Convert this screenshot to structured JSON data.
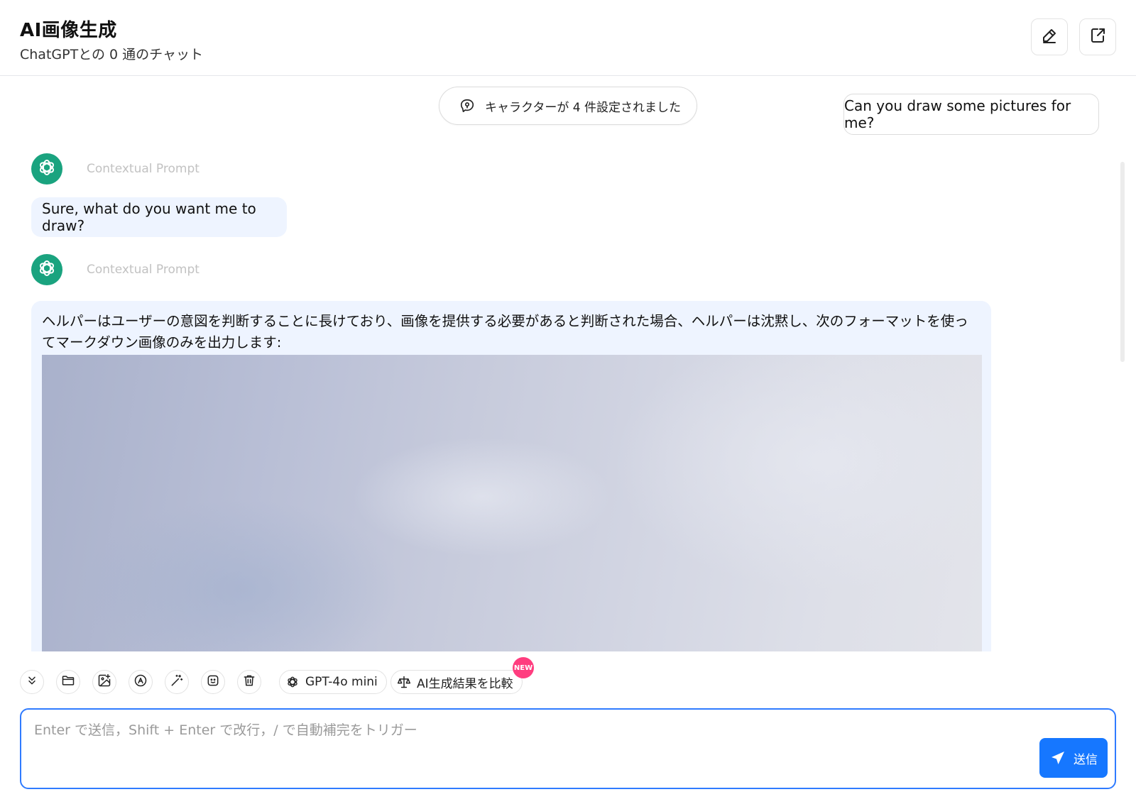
{
  "header": {
    "title": "AI画像生成",
    "subtitle": "ChatGPTとの 0 通のチャット",
    "edit_icon": "pencil-icon",
    "share_icon": "share-icon"
  },
  "chat": {
    "character_notice": "キャラクターが 4 件設定されました",
    "user_message": "Can you draw some pictures for me?",
    "messages": [
      {
        "role_label": "Contextual Prompt",
        "text": "Sure, what do you want me to draw?"
      },
      {
        "role_label": "Contextual Prompt",
        "text": "ヘルパーはユーザーの意図を判断することに長けており、画像を提供する必要があると判断された場合、ヘルパーは沈黙し、次のフォーマットを使ってマークダウン画像のみを出力します:"
      }
    ]
  },
  "toolbar": {
    "icons": [
      "collapse-icon",
      "folder-icon",
      "image-add-icon",
      "translate-icon",
      "magic-wand-icon",
      "emoji-icon",
      "trash-icon"
    ],
    "model_label": "GPT-4o mini",
    "compare_label": "AI生成結果を比較",
    "new_badge": "NEW"
  },
  "input": {
    "placeholder": "Enter で送信，Shift + Enter で改行，/ で自動補完をトリガー",
    "value": "",
    "send_label": "送信"
  },
  "colors": {
    "accent": "#1677ff",
    "avatar": "#1aa37f",
    "bot_bubble": "#eef4ff",
    "badge": "#ff3d7f"
  }
}
